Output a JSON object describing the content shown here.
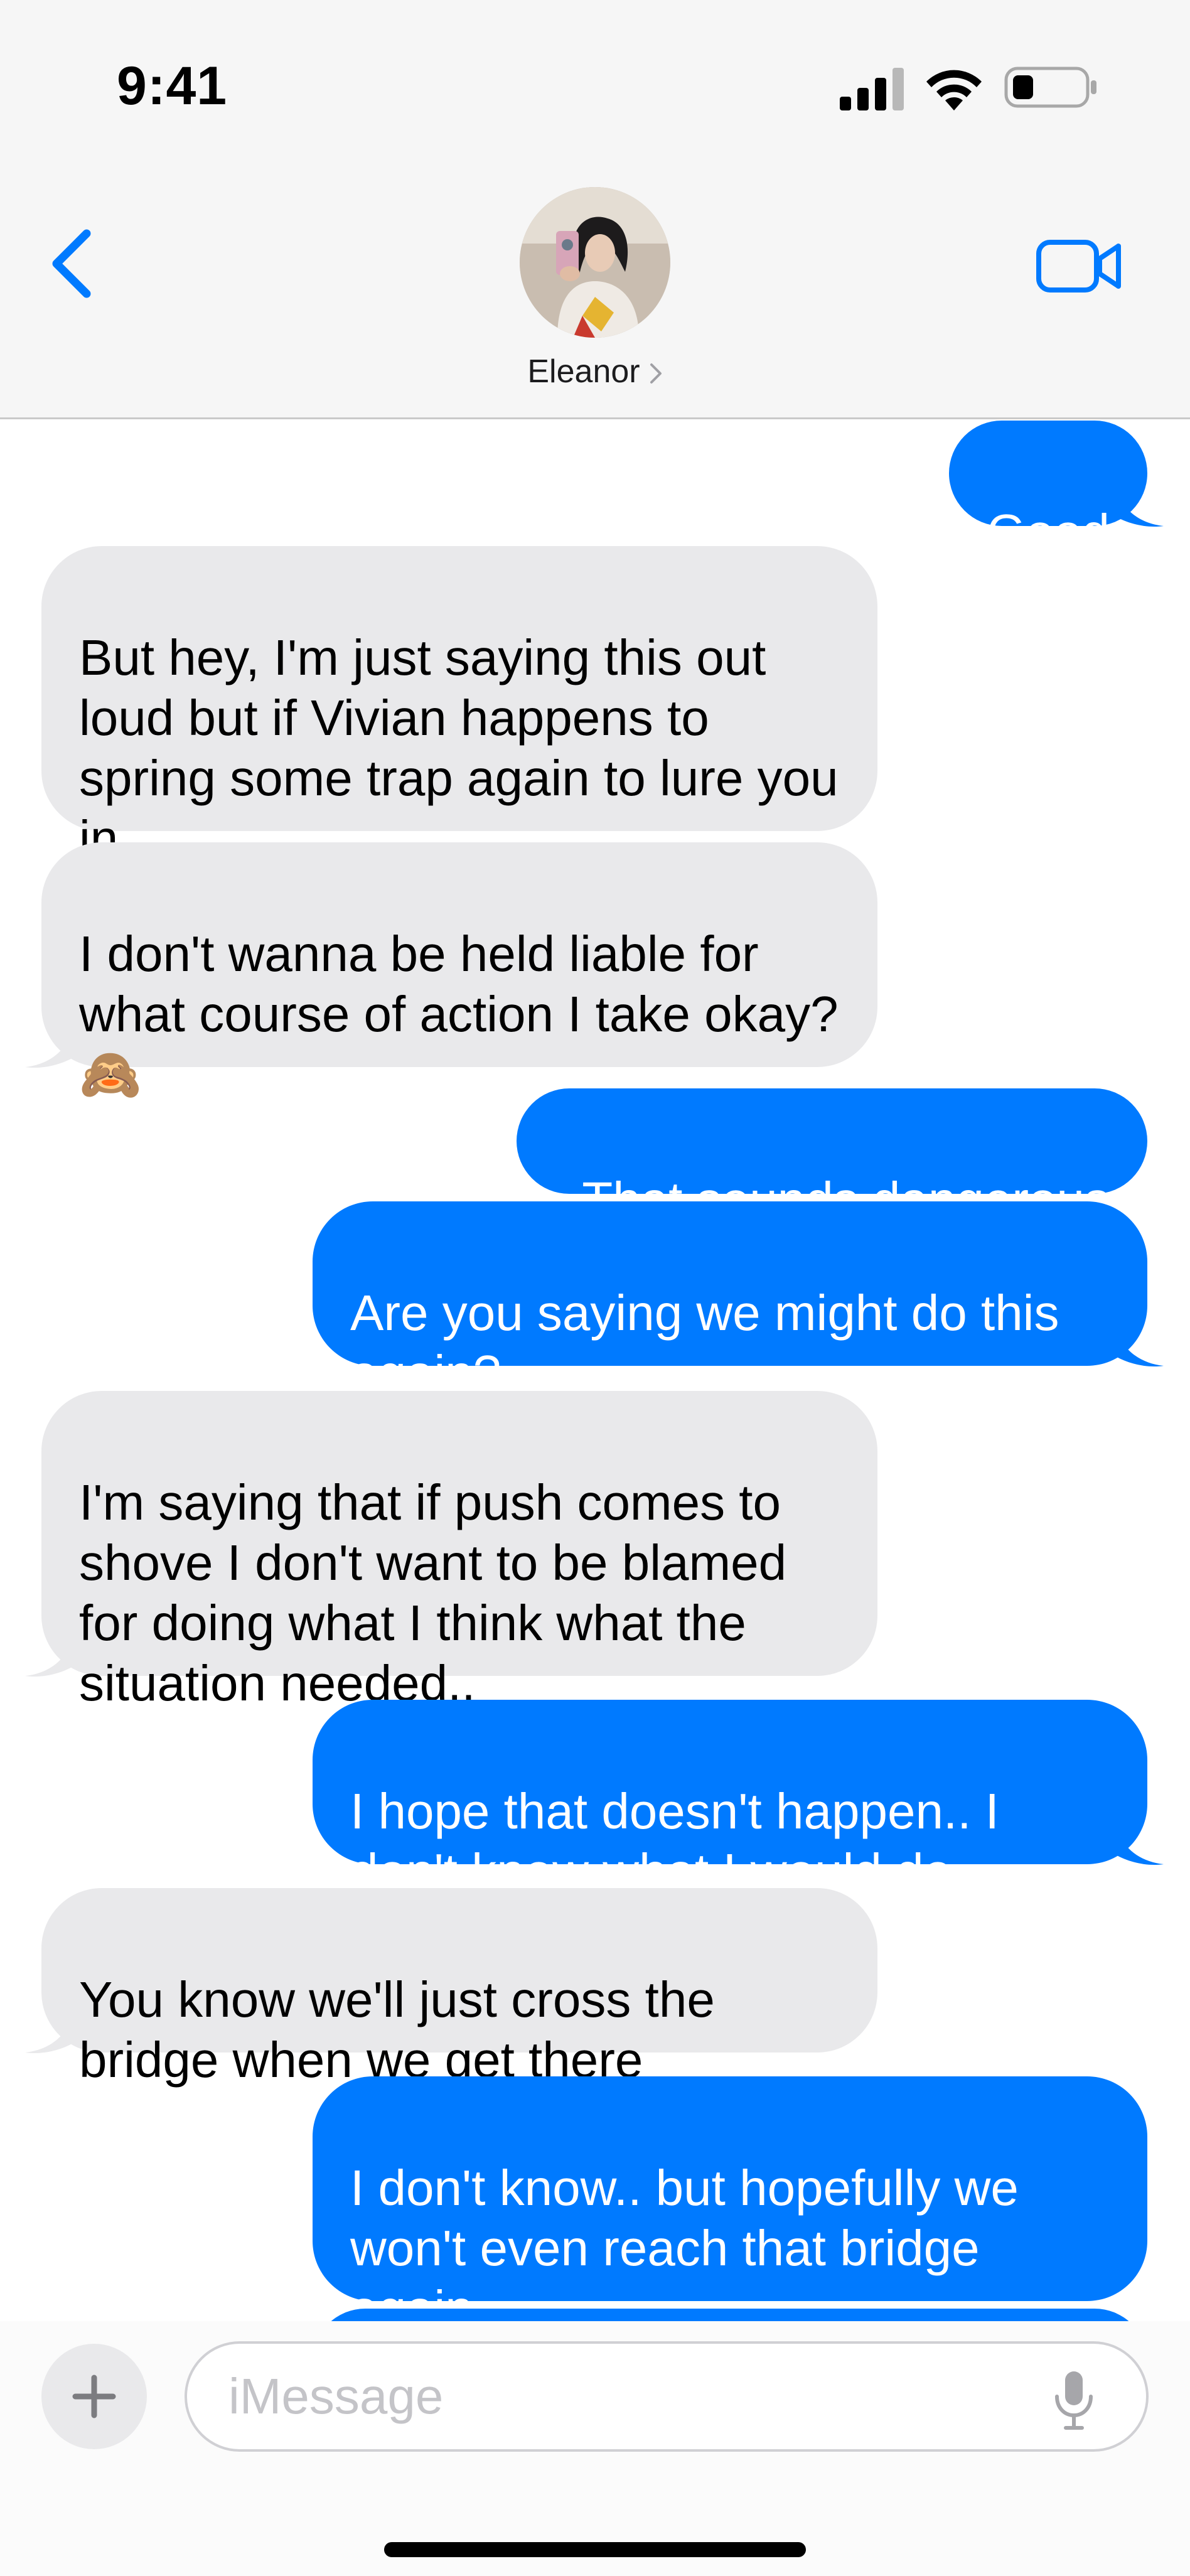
{
  "status": {
    "time": "9:41",
    "icons": [
      "cellular-signal-icon",
      "wifi-icon",
      "battery-icon"
    ]
  },
  "nav": {
    "back_icon": "chevron-left-icon",
    "contact_name": "Eleanor",
    "video_icon": "video-camera-icon"
  },
  "colors": {
    "sent_bubble": "#007aff",
    "received_bubble": "#e9e9eb",
    "accent": "#007aff"
  },
  "messages": [
    {
      "direction": "sent",
      "text": "Good"
    },
    {
      "direction": "received",
      "text": "But hey, I'm just saying this out loud but if Vivian happens to spring some trap again to lure you in.."
    },
    {
      "direction": "received",
      "text": "I don't wanna be held liable for what course of action I take okay? 🙈"
    },
    {
      "direction": "sent",
      "text": "..That sounds dangerous"
    },
    {
      "direction": "sent",
      "text": "Are you saying we might do this again?"
    },
    {
      "direction": "received",
      "text": "I'm saying that if push comes to shove I don't want to be blamed for doing what I think what the situation needed.."
    },
    {
      "direction": "sent",
      "text": "I hope that doesn't happen.. I don't know what I would do"
    },
    {
      "direction": "received",
      "text": "You know we'll just cross the bridge when we get there"
    },
    {
      "direction": "sent",
      "text": "I don't know.. but hopefully we won't even reach that bridge again"
    }
  ],
  "composer": {
    "plus_icon": "plus-icon",
    "placeholder": "iMessage",
    "value": "",
    "mic_icon": "microphone-icon"
  }
}
